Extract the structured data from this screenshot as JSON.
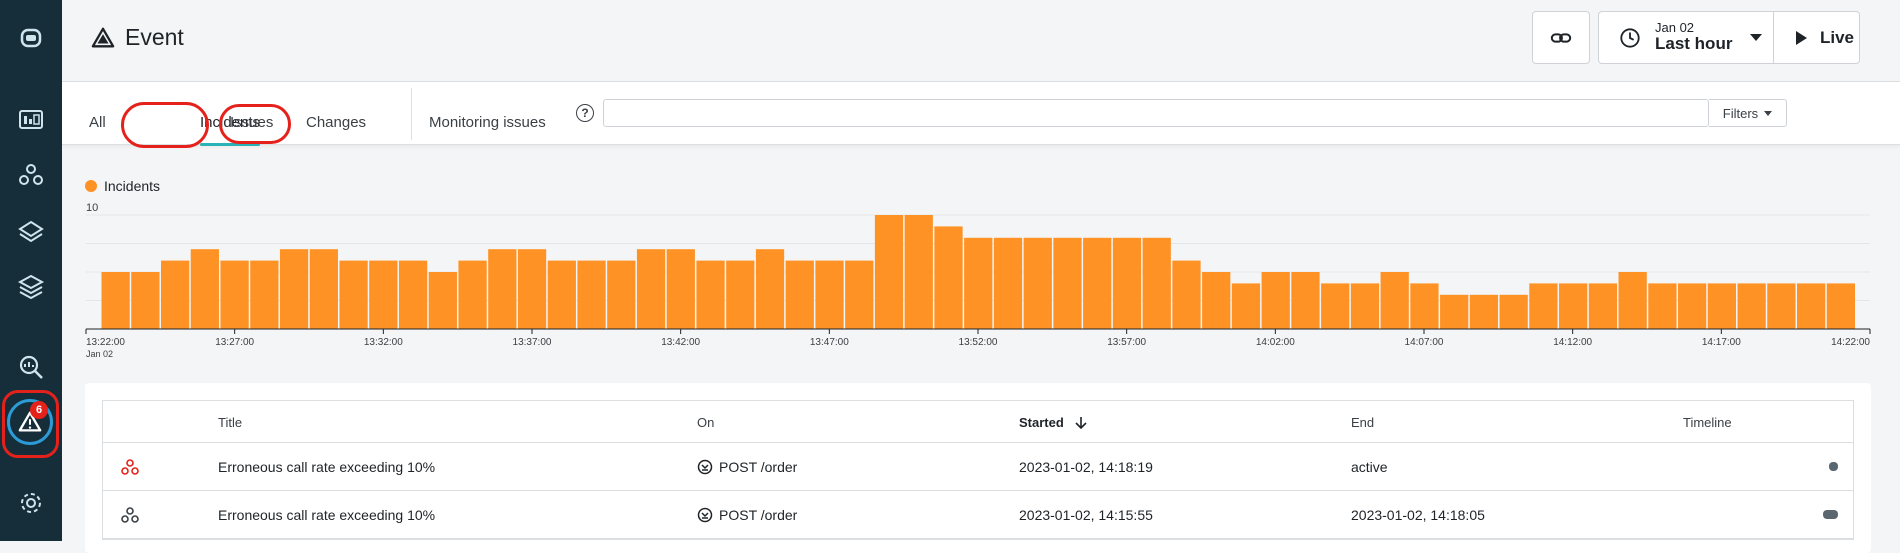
{
  "header": {
    "title": "Event",
    "time_sub": "Jan 02",
    "time_main": "Last hour",
    "live_label": "Live"
  },
  "sidebar": {
    "badge_count": "6",
    "items": [
      "robot-icon",
      "dashboard-icon",
      "services-icon",
      "layers-icon",
      "stack-icon",
      "search-icon",
      "event-icon",
      "settings-icon"
    ]
  },
  "tabs": {
    "all": "All",
    "incidents": "Incidents",
    "issues": "Issues",
    "changes": "Changes",
    "monitoring": "Monitoring issues",
    "search_placeholder": "",
    "filters": "Filters"
  },
  "chart_data": {
    "type": "bar",
    "series": [
      {
        "name": "Incidents",
        "values": [
          5,
          5,
          6,
          7,
          6,
          6,
          7,
          7,
          6,
          6,
          6,
          5,
          6,
          7,
          7,
          6,
          6,
          6,
          7,
          7,
          6,
          6,
          7,
          6,
          6,
          6,
          10,
          10,
          9,
          8,
          8,
          8,
          8,
          8,
          8,
          8,
          6,
          5,
          4,
          5,
          5,
          4,
          4,
          5,
          4,
          3,
          3,
          3,
          4,
          4,
          4,
          5,
          4,
          4,
          4,
          4,
          4,
          4,
          4
        ]
      }
    ],
    "ylim": [
      0,
      10
    ],
    "y_tick": "10",
    "x_ticks": [
      "13:22:00",
      "13:27:00",
      "13:32:00",
      "13:37:00",
      "13:42:00",
      "13:47:00",
      "13:52:00",
      "13:57:00",
      "14:02:00",
      "14:07:00",
      "14:12:00",
      "14:17:00",
      "14:22:00"
    ],
    "x_first_sublabel": "Jan 02",
    "color": "#ff9224",
    "grid": true
  },
  "table": {
    "headers": [
      "Title",
      "On",
      "Started",
      "End",
      "Timeline"
    ],
    "rows": [
      {
        "title": "Erroneous call rate exceeding 10%",
        "on": "POST /order",
        "started": "2023-01-02, 14:18:19",
        "end": "active",
        "icon_color": "#e4221b"
      },
      {
        "title": "Erroneous call rate exceeding 10%",
        "on": "POST /order",
        "started": "2023-01-02, 14:15:55",
        "end": "2023-01-02, 14:18:05",
        "icon_color": "#3a4045"
      }
    ]
  },
  "colors": {
    "accent": "#2ab2b9",
    "sidebar": "#152e3a",
    "annotation": "#e4221b",
    "bar": "#ff9224"
  }
}
